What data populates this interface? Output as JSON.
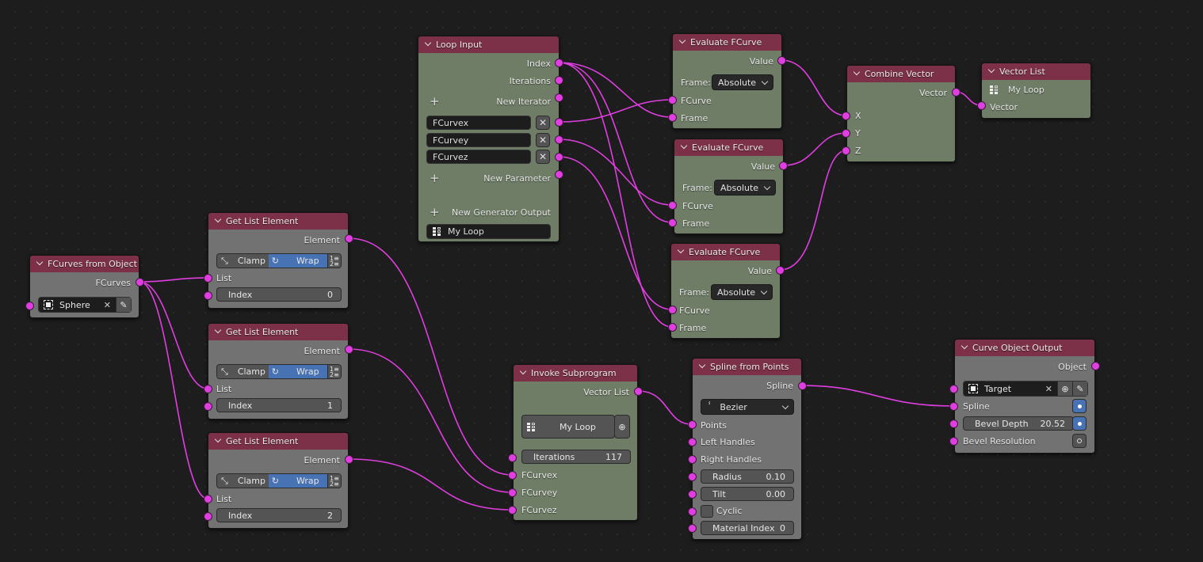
{
  "colors": {
    "background": "#1d1d1d",
    "header": "#7c3148",
    "node_green": "#6f7d67",
    "node_gray": "#727272",
    "socket": "#e03ee0",
    "accent_blue": "#4772b3"
  },
  "nodes": {
    "fcurves_from_object": {
      "title": "FCurves from Object",
      "output": "FCurves",
      "object_value": "Sphere"
    },
    "get_list_element_1": {
      "title": "Get List Element",
      "output": "Element",
      "clamp_label": "Clamp",
      "wrap_label": "Wrap",
      "wrap_selected": true,
      "input_list": "List",
      "index_label": "Index",
      "index_value": "0"
    },
    "get_list_element_2": {
      "title": "Get List Element",
      "output": "Element",
      "clamp_label": "Clamp",
      "wrap_label": "Wrap",
      "wrap_selected": true,
      "input_list": "List",
      "index_label": "Index",
      "index_value": "1"
    },
    "get_list_element_3": {
      "title": "Get List Element",
      "output": "Element",
      "clamp_label": "Clamp",
      "wrap_label": "Wrap",
      "wrap_selected": true,
      "input_list": "List",
      "index_label": "Index",
      "index_value": "2"
    },
    "loop_input": {
      "title": "Loop Input",
      "outputs": [
        "Index",
        "Iterations"
      ],
      "new_iterator": "New Iterator",
      "parameters": [
        "FCurvex",
        "FCurvey",
        "FCurvez"
      ],
      "new_parameter": "New Parameter",
      "new_generator_output": "New Generator Output",
      "loop_name": "My Loop"
    },
    "evaluate_fcurve_1": {
      "title": "Evaluate FCurve",
      "output": "Value",
      "frame_label": "Frame:",
      "frame_mode": "Absolute",
      "inputs": [
        "FCurve",
        "Frame"
      ]
    },
    "evaluate_fcurve_2": {
      "title": "Evaluate FCurve",
      "output": "Value",
      "frame_label": "Frame:",
      "frame_mode": "Absolute",
      "inputs": [
        "FCurve",
        "Frame"
      ]
    },
    "evaluate_fcurve_3": {
      "title": "Evaluate FCurve",
      "output": "Value",
      "frame_label": "Frame:",
      "frame_mode": "Absolute",
      "inputs": [
        "FCurve",
        "Frame"
      ]
    },
    "combine_vector": {
      "title": "Combine Vector",
      "output": "Vector",
      "inputs": [
        "X",
        "Y",
        "Z"
      ]
    },
    "vector_list": {
      "title": "Vector List",
      "loop_name": "My Loop",
      "input": "Vector"
    },
    "invoke_subprogram": {
      "title": "Invoke Subprogram",
      "output": "Vector List",
      "subprogram": "My Loop",
      "iterations_label": "Iterations",
      "iterations_value": "117",
      "inputs": [
        "FCurvex",
        "FCurvey",
        "FCurvez"
      ]
    },
    "spline_from_points": {
      "title": "Spline from Points",
      "output": "Spline",
      "spline_type": "Bezier",
      "inputs": [
        "Points",
        "Left Handles",
        "Right Handles"
      ],
      "radius_label": "Radius",
      "radius_value": "0.10",
      "tilt_label": "Tilt",
      "tilt_value": "0.00",
      "cyclic_label": "Cyclic",
      "cyclic_checked": false,
      "material_index_label": "Material Index",
      "material_index_value": "0"
    },
    "curve_object_output": {
      "title": "Curve Object Output",
      "output": "Object",
      "target_label": "Target",
      "spline_label": "Spline",
      "bevel_depth_label": "Bevel Depth",
      "bevel_depth_value": "20.52",
      "bevel_resolution_label": "Bevel Resolution"
    }
  }
}
